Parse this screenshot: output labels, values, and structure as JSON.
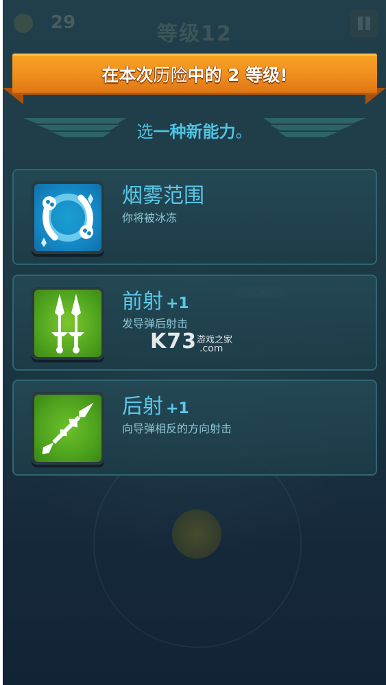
{
  "hud": {
    "coins": "29",
    "level_title": "等级12"
  },
  "banner": {
    "part1": "在本次",
    "part2": "历险",
    "part3": "中的 2 等级!"
  },
  "prompt": {
    "part1": "选",
    "part2": "一种新能力",
    "part3": "。"
  },
  "abilities": [
    {
      "title": "烟雾范围",
      "plus": "",
      "description": "你将被冰冻",
      "icon": "ice-orbit-icon"
    },
    {
      "title": "前射",
      "plus": "+1",
      "description": "发导弹后射击",
      "icon": "twin-daggers-icon"
    },
    {
      "title": "后射",
      "plus": "+1",
      "description": "向导弹相反的方向射击",
      "icon": "spear-icon"
    }
  ],
  "background": {
    "distance_label": "500"
  },
  "watermark": {
    "logo": "K73",
    "site_cn": "游戏之家",
    "domain": ".com"
  },
  "colors": {
    "banner": "#f08f1d",
    "accent_text": "#5cc8e8",
    "card_border": "#2e6672"
  }
}
